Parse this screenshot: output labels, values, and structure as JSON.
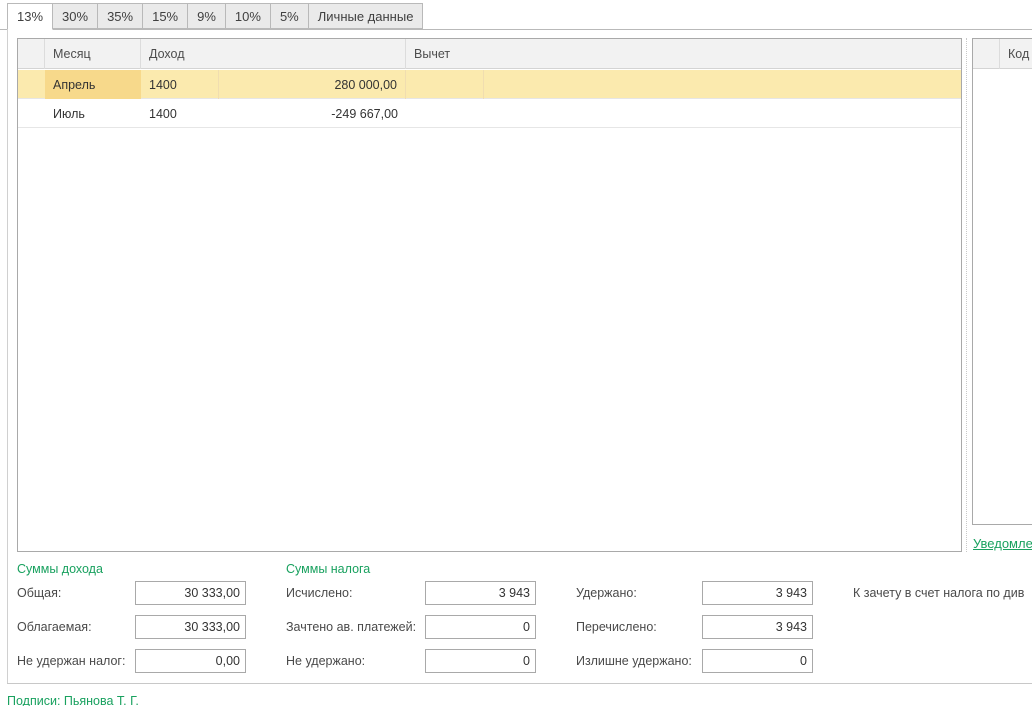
{
  "tabs": [
    "13%",
    "30%",
    "35%",
    "15%",
    "9%",
    "10%",
    "5%",
    "Личные данные"
  ],
  "grid": {
    "headers": {
      "month": "Месяц",
      "income": "Доход",
      "deduction": "Вычет"
    },
    "rows": [
      {
        "month": "Апрель",
        "code": "1400",
        "amount": "280 000,00"
      },
      {
        "month": "Июль",
        "code": "1400",
        "amount": "-249 667,00"
      }
    ]
  },
  "right_grid": {
    "header": "Код"
  },
  "notice_link": "Уведомле",
  "income_sums": {
    "title": "Суммы дохода",
    "total_label": "Общая:",
    "total_value": "30 333,00",
    "taxable_label": "Облагаемая:",
    "taxable_value": "30 333,00",
    "not_withheld_label": "Не удержан налог:",
    "not_withheld_value": "0,00"
  },
  "tax_sums": {
    "title": "Суммы налога",
    "calculated_label": "Исчислено:",
    "calculated_value": "3 943",
    "credited_label": "Зачтено ав. платежей:",
    "credited_value": "0",
    "not_withheld_label": "Не удержано:",
    "not_withheld_value": "0",
    "withheld_label": "Удержано:",
    "withheld_value": "3 943",
    "transferred_label": "Перечислено:",
    "transferred_value": "3 943",
    "excess_label": "Излишне удержано:",
    "excess_value": "0",
    "dividend_offset_label": "К зачету в счет налога по див"
  },
  "signatures": "Подписи: Пьянова Т. Г."
}
